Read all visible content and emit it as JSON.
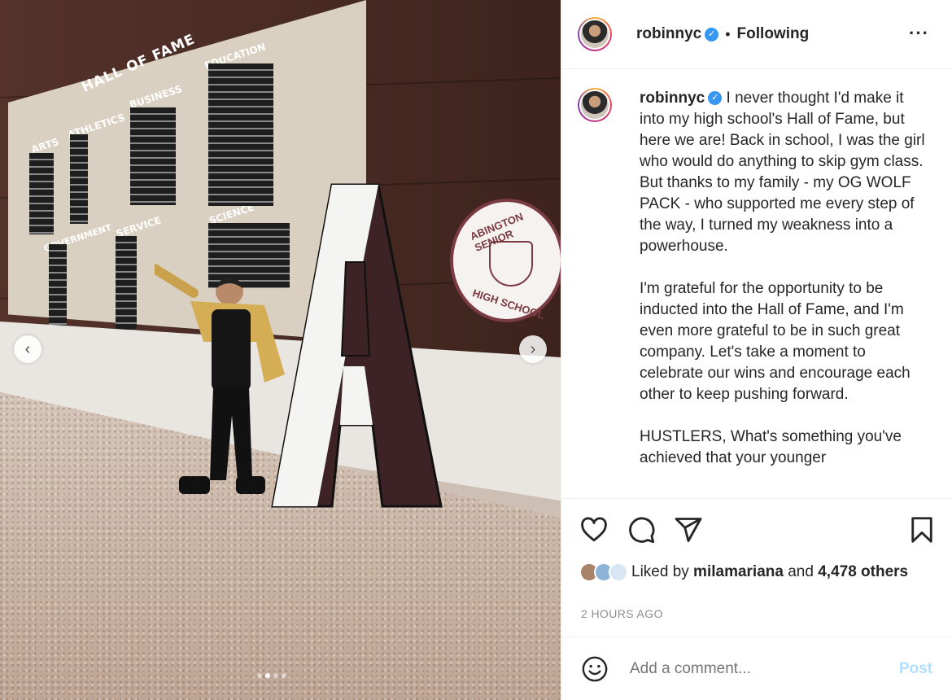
{
  "post": {
    "photo": {
      "wall_title": "HALL OF FAME",
      "categories": [
        "ARTS",
        "ATHLETICS",
        "BUSINESS",
        "EDUCATION",
        "GOVERNMENT",
        "SERVICE",
        "SCIENCE"
      ],
      "seal_top": "ABINGTON SENIOR",
      "seal_bottom": "HIGH SCHOOL",
      "carousel_count": 4,
      "carousel_active": 2
    },
    "header": {
      "username": "robinnyc",
      "separator": "•",
      "follow_status": "Following",
      "more_icon": "more-horizontal-icon"
    },
    "caption": {
      "username": "robinnyc",
      "text": " I never thought I'd make it into my high school's Hall of Fame, but here we are! Back in school, I was the girl who would do anything to skip gym class. But thanks to my family - my OG WOLF PACK - who supported me every step of the way, I turned my weakness into a powerhouse.\n\nI'm grateful for the opportunity to be inducted into the Hall of Fame, and I'm even more grateful to be in such great company. Let's take a moment to celebrate our wins and encourage each other to keep pushing forward.\n\nHUSTLERS, What's something you've achieved that your younger"
    },
    "likes": {
      "prefix": "Liked by ",
      "user": "milamariana",
      "middle": " and ",
      "count": "4,478",
      "suffix": " others"
    },
    "timestamp": "2 HOURS AGO",
    "comment": {
      "placeholder": "Add a comment...",
      "post_label": "Post"
    },
    "colors": {
      "verified": "#3897f0",
      "post_disabled": "#b2dffc",
      "text": "#262626",
      "muted": "#8e8e8e"
    }
  }
}
